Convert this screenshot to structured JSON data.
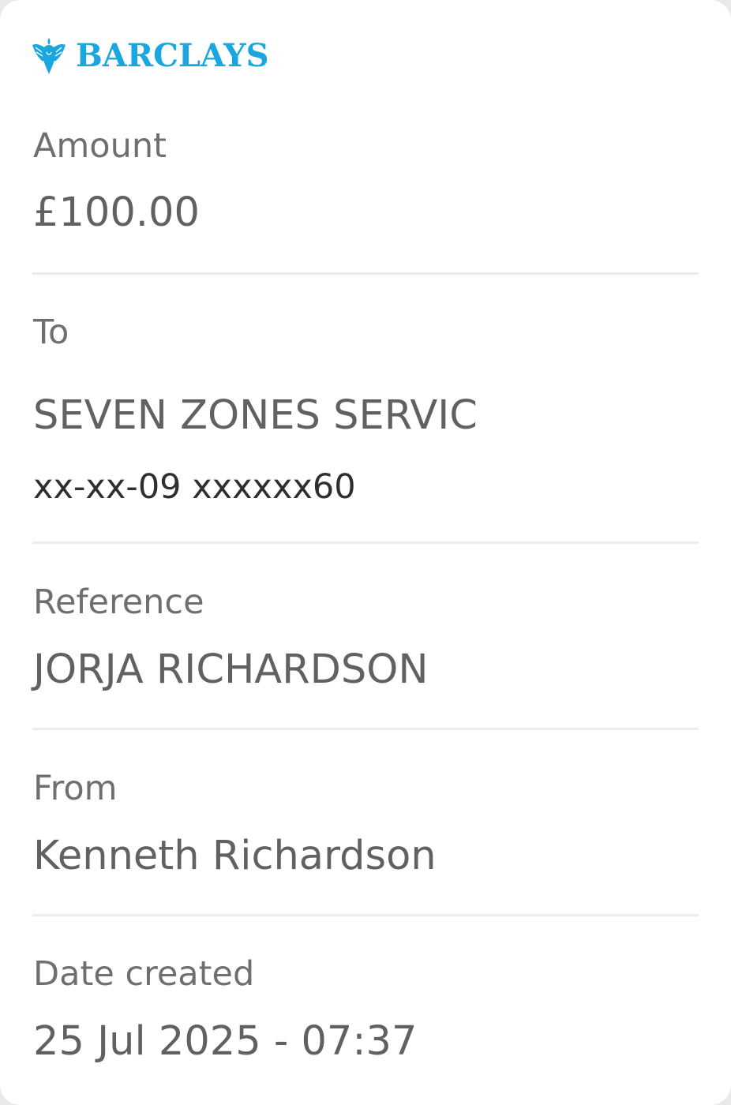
{
  "brand": {
    "name": "BARCLAYS",
    "color": "#1aa7e0",
    "icon": "eagle-icon"
  },
  "fields": {
    "amount": {
      "label": "Amount",
      "value": "£100.00"
    },
    "to": {
      "label": "To",
      "value": "SEVEN ZONES SERVIC",
      "account": "xx-xx-09 xxxxxx60"
    },
    "reference": {
      "label": "Reference",
      "value": "JORJA RICHARDSON"
    },
    "from": {
      "label": "From",
      "value": "Kenneth Richardson"
    },
    "date_created": {
      "label": "Date created",
      "value": "25 Jul 2025 - 07:37"
    }
  }
}
